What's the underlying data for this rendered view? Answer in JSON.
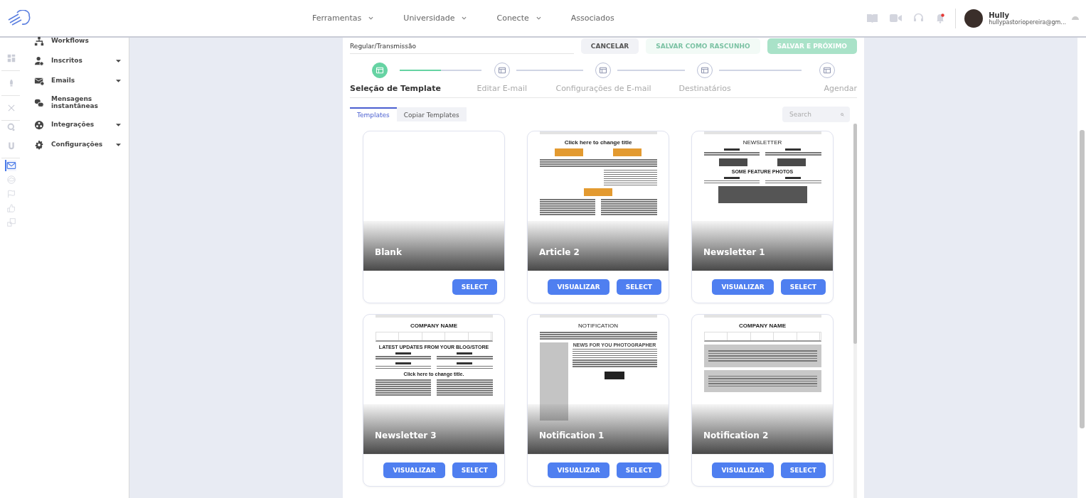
{
  "header": {
    "nav": [
      {
        "label": "Ferramentas",
        "dropdown": true
      },
      {
        "label": "Universidade",
        "dropdown": true
      },
      {
        "label": "Conecte",
        "dropdown": true
      },
      {
        "label": "Associados",
        "dropdown": false
      }
    ],
    "has_notification": true,
    "user": {
      "name": "Hully",
      "email": "hullypastoriopereira@gm..."
    }
  },
  "rail": [
    {
      "selected": false
    },
    {
      "selected": false
    },
    {
      "selected": false
    },
    {
      "selected": false
    },
    {
      "selected": false
    },
    {
      "selected": true
    },
    {
      "selected": false
    },
    {
      "selected": false
    },
    {
      "selected": false
    },
    {
      "selected": false
    }
  ],
  "sidebar": {
    "items": [
      {
        "label": "Workflows",
        "expandable": false
      },
      {
        "label": "Inscritos",
        "expandable": true
      },
      {
        "label": "Emails",
        "expandable": true
      },
      {
        "label": "Mensagens instantâneas",
        "expandable": false
      },
      {
        "label": "Integrações",
        "expandable": true
      },
      {
        "label": "Configurações",
        "expandable": true
      }
    ]
  },
  "form": {
    "type_field": {
      "value": "Regular/Transmissão"
    },
    "buttons": [
      {
        "label": "CANCELAR",
        "kind": "plain",
        "disabled": false
      },
      {
        "label": "SALVAR COMO RASCUNHO",
        "kind": "soft",
        "disabled": true
      },
      {
        "label": "SALVAR E PRÓXIMO",
        "kind": "primary",
        "disabled": true
      }
    ]
  },
  "steps": [
    {
      "label": "Seleção de Template",
      "selected": true,
      "level": 0.5
    },
    {
      "label": "Editar E-mail",
      "selected": false
    },
    {
      "label": "Configurações de E-mail",
      "selected": false
    },
    {
      "label": "Destinatários",
      "selected": false
    },
    {
      "label": "Agendar",
      "selected": false
    }
  ],
  "tabs": [
    {
      "label": "Templates",
      "selected": true
    },
    {
      "label": "Copiar Templates",
      "selected": false
    }
  ],
  "search": {
    "placeholder": "Search"
  },
  "templates": [
    {
      "name": "Blank",
      "buttons": [
        "SELECT"
      ]
    },
    {
      "name": "Article 2",
      "buttons": [
        "VISUALIZAR",
        "SELECT"
      ],
      "preview": [
        {
          "kind": "title",
          "text": "Click here to change title"
        },
        {
          "kind": "two-buttons"
        },
        {
          "kind": "lines"
        },
        {
          "kind": "right-lines"
        },
        {
          "kind": "one-button"
        },
        {
          "kind": "cols"
        }
      ]
    },
    {
      "name": "Newsletter 1",
      "buttons": [
        "VISUALIZAR",
        "SELECT"
      ],
      "preview": [
        {
          "kind": "plain-title",
          "text": "NEWSLETTER"
        },
        {
          "kind": "pair"
        },
        {
          "kind": "dark-buttons"
        },
        {
          "kind": "heading",
          "text": "SOME FEATURE PHOTOS"
        },
        {
          "kind": "pair"
        },
        {
          "kind": "dark-box"
        }
      ]
    },
    {
      "name": "Newsletter 3",
      "buttons": [
        "VISUALIZAR",
        "SELECT"
      ],
      "preview": [
        {
          "kind": "title",
          "text": "COMPANY NAME"
        },
        {
          "kind": "navbar"
        },
        {
          "kind": "heading",
          "text": "LATEST UPDATES FROM YOUR BLOG/STORE"
        },
        {
          "kind": "pair"
        },
        {
          "kind": "pair"
        },
        {
          "kind": "heading",
          "text": "Click here to change title."
        },
        {
          "kind": "cols"
        }
      ]
    },
    {
      "name": "Notification 1",
      "buttons": [
        "VISUALIZAR",
        "SELECT"
      ],
      "preview": [
        {
          "kind": "plain-title",
          "text": "NOTIFICATION"
        },
        {
          "kind": "lines"
        },
        {
          "kind": "feature",
          "text": "NEWS FOR YOU PHOTOGRAPHER"
        }
      ]
    },
    {
      "name": "Notification 2",
      "buttons": [
        "VISUALIZAR",
        "SELECT"
      ],
      "preview": [
        {
          "kind": "title",
          "text": "COMPANY NAME"
        },
        {
          "kind": "navbar"
        },
        {
          "kind": "image-block"
        },
        {
          "kind": "image-block"
        }
      ]
    }
  ]
}
